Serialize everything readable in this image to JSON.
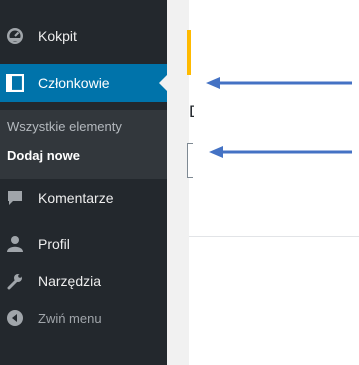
{
  "sidebar": {
    "items": [
      {
        "label": "Kokpit",
        "icon": "dashboard-icon"
      },
      {
        "label": "Członkowie",
        "icon": "members-icon",
        "active": true
      },
      {
        "label": "Komentarze",
        "icon": "comment-icon"
      },
      {
        "label": "Profil",
        "icon": "user-icon"
      },
      {
        "label": "Narzędzia",
        "icon": "wrench-icon"
      },
      {
        "label": "Zwiń menu",
        "icon": "collapse-icon"
      }
    ],
    "submenu": [
      {
        "label": "Wszystkie elementy"
      },
      {
        "label": "Dodaj nowe",
        "current": true
      }
    ]
  },
  "content": {
    "heading_fragment": "D"
  },
  "colors": {
    "sidebar_bg": "#23282d",
    "submenu_bg": "#32373c",
    "active_bg": "#0073aa",
    "notice_accent": "#ffba00",
    "arrow": "#4472c4"
  },
  "annotations": [
    {
      "icon": "arrow-left-icon",
      "points_to": "Członkowie"
    },
    {
      "icon": "arrow-left-icon",
      "points_to": "Dodaj nowe"
    }
  ]
}
